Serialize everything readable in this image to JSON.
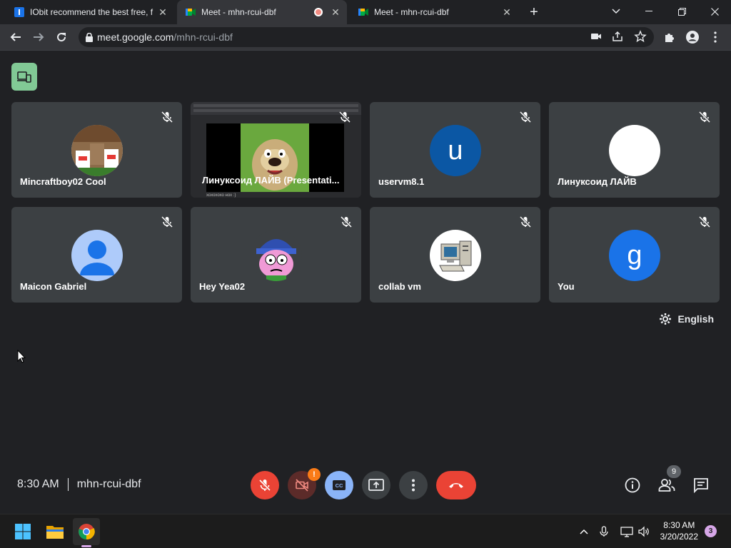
{
  "browser": {
    "tabs": [
      {
        "title": "IObit recommend the best free, f",
        "active": false
      },
      {
        "title": "Meet - mhn-rcui-dbf",
        "active": true,
        "recording": true
      },
      {
        "title": "Meet - mhn-rcui-dbf",
        "active": false
      }
    ],
    "url_host": "meet.google.com",
    "url_path": "/mhn-rcui-dbf"
  },
  "meet": {
    "participants": [
      {
        "name": "Mincraftboy02 Cool",
        "avatar": "photo",
        "muted": true
      },
      {
        "name": "Линуксоид ЛАЙВ (Presentati...",
        "avatar": "presentation",
        "muted": true,
        "presentation_caption": "хохохохо нох :)"
      },
      {
        "name": "uservm8.1",
        "avatar": "letter",
        "letter": "u",
        "color": "#0b57a4",
        "muted": true
      },
      {
        "name": "Линуксоид ЛАЙВ",
        "avatar": "blank",
        "color": "#ffffff",
        "muted": true
      },
      {
        "name": "Maicon Gabriel",
        "avatar": "default-person",
        "color": "#aecbfa",
        "muted": true
      },
      {
        "name": "Hey Yea02",
        "avatar": "cartoon",
        "muted": true
      },
      {
        "name": "collab vm",
        "avatar": "computer",
        "muted": true
      },
      {
        "name": "You",
        "avatar": "letter",
        "letter": "g",
        "color": "#1a73e8",
        "muted": true
      }
    ],
    "caption_language": "English",
    "time": "8:30 AM",
    "meeting_code": "mhn-rcui-dbf",
    "camera_warning": "!",
    "participant_count": "9"
  },
  "taskbar": {
    "time": "8:30 AM",
    "date": "3/20/2022",
    "notifications": "3"
  },
  "colors": {
    "accent_red": "#ea4335",
    "cc_blue": "#8ab4f8",
    "companion_green": "#81c995"
  }
}
